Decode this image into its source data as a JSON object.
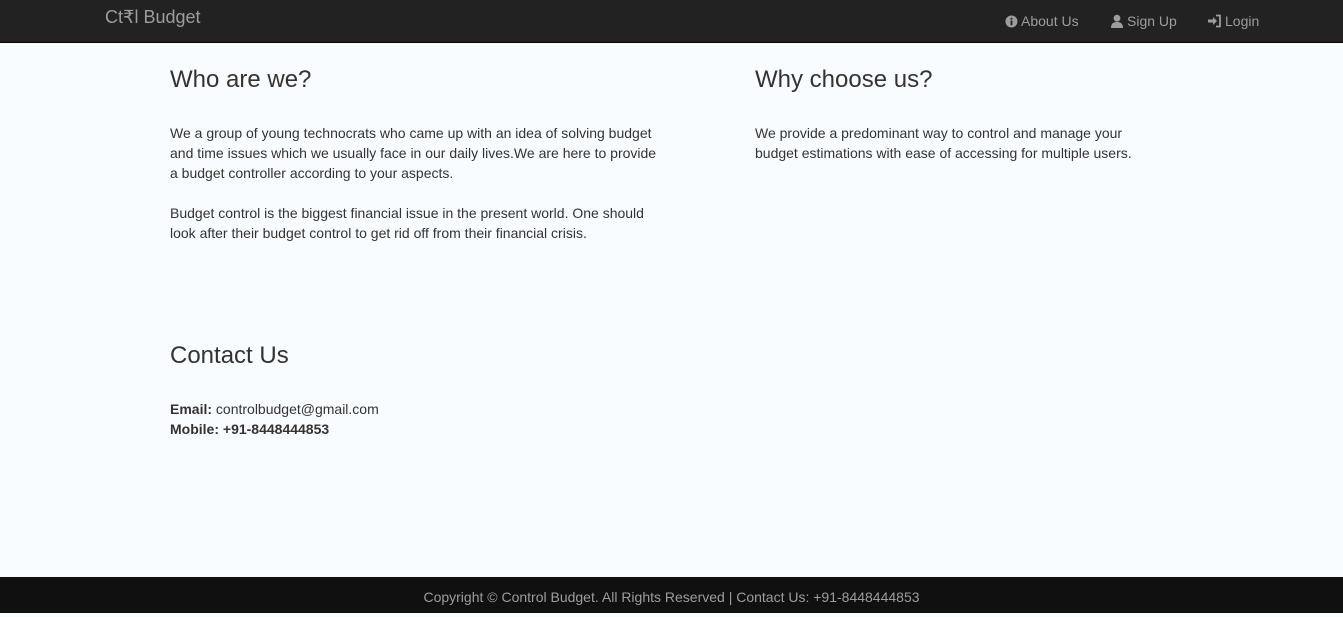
{
  "navbar": {
    "brand": "Ct₹l Budget",
    "links": [
      {
        "label": "About Us",
        "icon": "info-circle-icon"
      },
      {
        "label": "Sign Up",
        "icon": "user-icon"
      },
      {
        "label": "Login",
        "icon": "login-icon"
      }
    ]
  },
  "about": {
    "heading": "Who are we?",
    "para1_line1": "We a group of young technocrats who came up with an idea of solving budget",
    "para1_line2": "and time issues which we usually face in our daily lives.We are here to provide",
    "para1_line3": "a budget controller according to your aspects.",
    "para2_line1": "Budget control is the biggest financial issue in the present world. One should",
    "para2_line2": "look after their budget control to get rid off from their financial crisis."
  },
  "why": {
    "heading": "Why choose us?",
    "line1": "We provide a predominant way to control and manage your",
    "line2": "budget estimations with ease of accessing for multiple users."
  },
  "contact": {
    "heading": "Contact Us",
    "email_label": "Email:",
    "email_value": "controlbudget@gmail.com",
    "mobile_label": "Mobile:",
    "mobile_value": "+91-8448444853"
  },
  "footer": {
    "text": "Copyright © Control Budget. All Rights Reserved | Contact Us: +91-8448444853"
  },
  "colors": {
    "navbar_bg": "#222222",
    "footer_bg": "#101010",
    "page_bg": "#f8fcff",
    "nav_text": "#9d9d9d"
  }
}
